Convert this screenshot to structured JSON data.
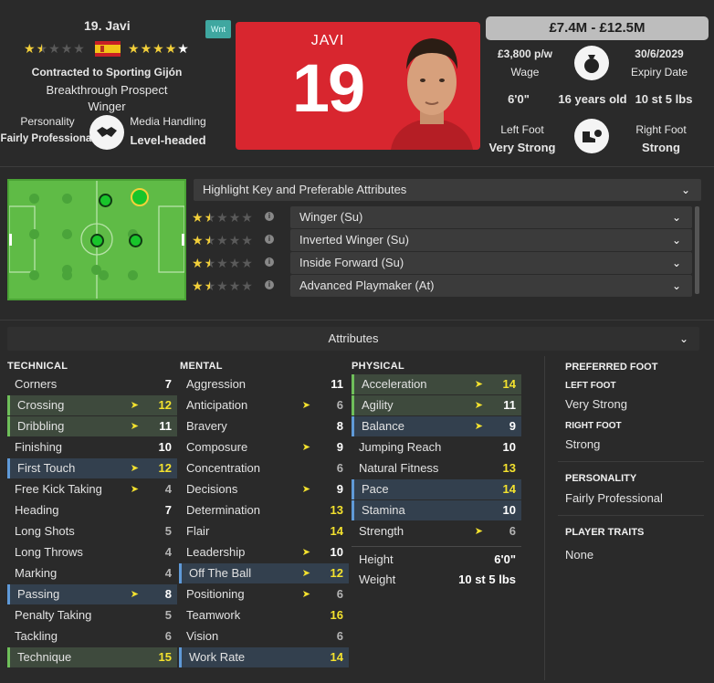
{
  "player": {
    "name_line": "19. Javi",
    "contract": "Contracted to Sporting Gijón",
    "status": "Breakthrough Prospect",
    "position": "Winger",
    "personality_label": "Personality",
    "personality_value": "Fairly Professional",
    "media_label": "Media Handling",
    "media_value": "Level-headed",
    "badge": "Wnt",
    "current_ability_stars": 1.5,
    "potential_ability_stars": 4.5
  },
  "shirt": {
    "name": "JAVI",
    "number": "19"
  },
  "value": "£7.4M - £12.5M",
  "info": {
    "wage": "£3,800 p/w",
    "wage_label": "Wage",
    "expiry": "30/6/2029",
    "expiry_label": "Expiry Date",
    "height": "6'0\"",
    "age": "16 years old",
    "weight": "10 st 5 lbs",
    "left_foot_label": "Left Foot",
    "left_foot": "Very Strong",
    "right_foot_label": "Right Foot",
    "right_foot": "Strong"
  },
  "roles": {
    "header": "Highlight Key and Preferable Attributes",
    "items": [
      {
        "label": "Winger (Su)",
        "stars": 1.5
      },
      {
        "label": "Inverted Winger (Su)",
        "stars": 1.5
      },
      {
        "label": "Inside Forward (Su)",
        "stars": 1.5
      },
      {
        "label": "Advanced Playmaker (At)",
        "stars": 1.5
      }
    ]
  },
  "attributes_header": "Attributes",
  "technical": {
    "title": "TECHNICAL",
    "rows": [
      {
        "name": "Corners",
        "value": "7",
        "hl": "",
        "arrow": false,
        "color": "white"
      },
      {
        "name": "Crossing",
        "value": "12",
        "hl": "green",
        "arrow": true,
        "color": "yellow"
      },
      {
        "name": "Dribbling",
        "value": "11",
        "hl": "green",
        "arrow": true,
        "color": "white"
      },
      {
        "name": "Finishing",
        "value": "10",
        "hl": "",
        "arrow": false,
        "color": "white"
      },
      {
        "name": "First Touch",
        "value": "12",
        "hl": "blue",
        "arrow": true,
        "color": "yellow"
      },
      {
        "name": "Free Kick Taking",
        "value": "4",
        "hl": "",
        "arrow": true,
        "color": "gray"
      },
      {
        "name": "Heading",
        "value": "7",
        "hl": "",
        "arrow": false,
        "color": "white"
      },
      {
        "name": "Long Shots",
        "value": "5",
        "hl": "",
        "arrow": false,
        "color": "gray"
      },
      {
        "name": "Long Throws",
        "value": "4",
        "hl": "",
        "arrow": false,
        "color": "gray"
      },
      {
        "name": "Marking",
        "value": "4",
        "hl": "",
        "arrow": false,
        "color": "gray"
      },
      {
        "name": "Passing",
        "value": "8",
        "hl": "blue",
        "arrow": true,
        "color": "white"
      },
      {
        "name": "Penalty Taking",
        "value": "5",
        "hl": "",
        "arrow": false,
        "color": "gray"
      },
      {
        "name": "Tackling",
        "value": "6",
        "hl": "",
        "arrow": false,
        "color": "gray"
      },
      {
        "name": "Technique",
        "value": "15",
        "hl": "green",
        "arrow": false,
        "color": "yellow"
      }
    ]
  },
  "mental": {
    "title": "MENTAL",
    "rows": [
      {
        "name": "Aggression",
        "value": "11",
        "hl": "",
        "arrow": false,
        "color": "white"
      },
      {
        "name": "Anticipation",
        "value": "6",
        "hl": "",
        "arrow": true,
        "color": "gray"
      },
      {
        "name": "Bravery",
        "value": "8",
        "hl": "",
        "arrow": false,
        "color": "white"
      },
      {
        "name": "Composure",
        "value": "9",
        "hl": "",
        "arrow": true,
        "color": "white"
      },
      {
        "name": "Concentration",
        "value": "6",
        "hl": "",
        "arrow": false,
        "color": "gray"
      },
      {
        "name": "Decisions",
        "value": "9",
        "hl": "",
        "arrow": true,
        "color": "white"
      },
      {
        "name": "Determination",
        "value": "13",
        "hl": "",
        "arrow": false,
        "color": "yellow"
      },
      {
        "name": "Flair",
        "value": "14",
        "hl": "",
        "arrow": false,
        "color": "yellow"
      },
      {
        "name": "Leadership",
        "value": "10",
        "hl": "",
        "arrow": true,
        "color": "white"
      },
      {
        "name": "Off The Ball",
        "value": "12",
        "hl": "blue",
        "arrow": true,
        "color": "yellow"
      },
      {
        "name": "Positioning",
        "value": "6",
        "hl": "",
        "arrow": true,
        "color": "gray"
      },
      {
        "name": "Teamwork",
        "value": "16",
        "hl": "",
        "arrow": false,
        "color": "yellow"
      },
      {
        "name": "Vision",
        "value": "6",
        "hl": "",
        "arrow": false,
        "color": "gray"
      },
      {
        "name": "Work Rate",
        "value": "14",
        "hl": "blue",
        "arrow": false,
        "color": "yellow"
      }
    ]
  },
  "physical": {
    "title": "PHYSICAL",
    "rows": [
      {
        "name": "Acceleration",
        "value": "14",
        "hl": "green",
        "arrow": true,
        "color": "yellow"
      },
      {
        "name": "Agility",
        "value": "11",
        "hl": "green",
        "arrow": true,
        "color": "white"
      },
      {
        "name": "Balance",
        "value": "9",
        "hl": "blue",
        "arrow": true,
        "color": "white"
      },
      {
        "name": "Jumping Reach",
        "value": "10",
        "hl": "",
        "arrow": false,
        "color": "white"
      },
      {
        "name": "Natural Fitness",
        "value": "13",
        "hl": "",
        "arrow": false,
        "color": "yellow"
      },
      {
        "name": "Pace",
        "value": "14",
        "hl": "blue",
        "arrow": false,
        "color": "yellow"
      },
      {
        "name": "Stamina",
        "value": "10",
        "hl": "blue",
        "arrow": false,
        "color": "white"
      },
      {
        "name": "Strength",
        "value": "6",
        "hl": "",
        "arrow": true,
        "color": "gray"
      }
    ],
    "height_label": "Height",
    "height": "6'0\"",
    "weight_label": "Weight",
    "weight": "10 st 5 lbs"
  },
  "side": {
    "preferred_foot_title": "PREFERRED FOOT",
    "left_foot_title": "LEFT FOOT",
    "left_foot": "Very Strong",
    "right_foot_title": "RIGHT FOOT",
    "right_foot": "Strong",
    "personality_title": "PERSONALITY",
    "personality": "Fairly Professional",
    "traits_title": "PLAYER TRAITS",
    "traits": "None"
  },
  "colors": {
    "background": "#2a2a2a",
    "shirt_red": "#d8262f",
    "star_gold": "#f2cf3a",
    "value_yellow": "#f4e22e",
    "highlight_green": "#3e4a3d",
    "highlight_blue": "#33404e",
    "pitch_green": "#5fbb46"
  }
}
